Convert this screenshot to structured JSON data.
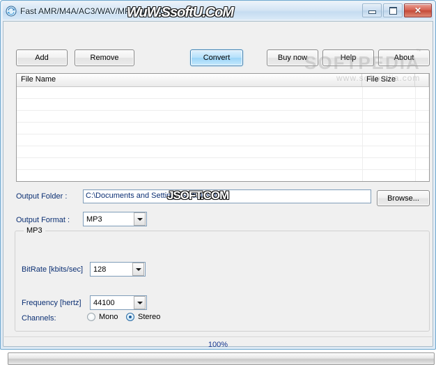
{
  "window": {
    "title": "Fast AMR/M4A/AC3/WAV/MP3/WMA Converter",
    "icon": "app-converter-icon",
    "controls": {
      "minimize": "minimize-icon",
      "maximize": "maximize-icon",
      "close": "close-icon",
      "close_glyph": "✕"
    }
  },
  "toolbar": {
    "add_label": "Add",
    "remove_label": "Remove",
    "convert_label": "Convert",
    "buy_now_label": "Buy now",
    "help_label": "Help",
    "about_label": "About",
    "accent_color": "#9bd4f7"
  },
  "file_list": {
    "columns": [
      "File Name",
      "File Size"
    ],
    "rows": [],
    "empty": true
  },
  "output": {
    "folder_label": "Output Folder :",
    "folder_value": "C:\\Documents and Settings\\Soft\\Desktop",
    "browse_label": "Browse...",
    "format_label": "Output Format :",
    "format_value": "MP3"
  },
  "settings_group": {
    "title": "MP3",
    "bitrate_label": "BitRate [kbits/sec]",
    "bitrate_value": "128",
    "frequency_label": "Frequency [hertz]",
    "frequency_value": "44100",
    "channels_label": "Channels:",
    "channel_mono_label": "Mono",
    "channel_stereo_label": "Stereo",
    "channel_selected": "Stereo"
  },
  "status": {
    "percent_text": "100%",
    "percent_color": "#12348f",
    "progress_value": 0
  },
  "watermarks": {
    "title_overlay": "WuW.SsoftU.CoM",
    "folder_overlay": "JSOFT.COM",
    "softpedia_buttons": "SOFTPEDIA",
    "softpedia_tm": "™",
    "softpedia_list": "www.softpedia.com"
  }
}
